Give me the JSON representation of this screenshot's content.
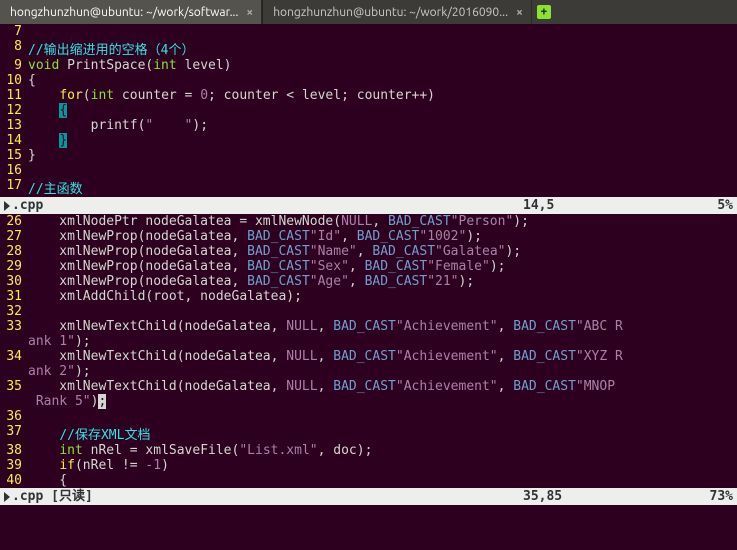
{
  "tabs": [
    {
      "label": "hongzhunzhun@ubuntu: ~/work/softwar...",
      "active": true
    },
    {
      "label": "hongzhunzhun@ubuntu: ~/work/2016090...",
      "active": false
    }
  ],
  "pane1": {
    "filename_suffix": ".cpp",
    "cursor_pos": "14,5",
    "scroll_pct": "5%",
    "lines": [
      {
        "n": 7,
        "tokens": []
      },
      {
        "n": 8,
        "tokens": [
          {
            "t": "//输出缩进用的空格（4个）",
            "cls": "c-comment"
          }
        ]
      },
      {
        "n": 9,
        "tokens": [
          {
            "t": "void",
            "cls": "c-type"
          },
          {
            "t": " PrintSpace("
          },
          {
            "t": "int",
            "cls": "c-type"
          },
          {
            "t": " level)"
          }
        ]
      },
      {
        "n": 10,
        "tokens": [
          {
            "t": "{"
          }
        ]
      },
      {
        "n": 11,
        "tokens": [
          {
            "t": "    "
          },
          {
            "t": "for",
            "cls": "c-kw"
          },
          {
            "t": "("
          },
          {
            "t": "int",
            "cls": "c-type"
          },
          {
            "t": " counter = "
          },
          {
            "t": "0",
            "cls": "c-num"
          },
          {
            "t": "; counter < level; counter++)"
          }
        ]
      },
      {
        "n": 12,
        "tokens": [
          {
            "t": "    "
          },
          {
            "t": "{",
            "cls": "hlbrace"
          }
        ]
      },
      {
        "n": 13,
        "tokens": [
          {
            "t": "        printf("
          },
          {
            "t": "\"    \"",
            "cls": "c-str"
          },
          {
            "t": ");"
          }
        ]
      },
      {
        "n": 14,
        "tokens": [
          {
            "t": "    "
          },
          {
            "t": "}",
            "cls": "hlbrace"
          }
        ]
      },
      {
        "n": 15,
        "tokens": [
          {
            "t": "}"
          }
        ]
      },
      {
        "n": 16,
        "tokens": []
      },
      {
        "n": 17,
        "tokens": [
          {
            "t": "//主函数",
            "cls": "c-comment"
          }
        ]
      }
    ]
  },
  "pane2": {
    "filename_suffix": ".cpp",
    "readonly_label": " [只读]",
    "cursor_pos": "35,85",
    "scroll_pct": "73%",
    "lines": [
      {
        "n": 26,
        "tokens": [
          {
            "t": "    xmlNodePtr nodeGalatea = xmlNewNode("
          },
          {
            "t": "NULL",
            "cls": "c-null"
          },
          {
            "t": ", "
          },
          {
            "t": "BAD_CAST",
            "cls": "c-macro"
          },
          {
            "t": "\"Person\"",
            "cls": "c-str"
          },
          {
            "t": ");"
          }
        ]
      },
      {
        "n": 27,
        "tokens": [
          {
            "t": "    xmlNewProp(nodeGalatea, "
          },
          {
            "t": "BAD_CAST",
            "cls": "c-macro"
          },
          {
            "t": "\"Id\"",
            "cls": "c-str"
          },
          {
            "t": ", "
          },
          {
            "t": "BAD_CAST",
            "cls": "c-macro"
          },
          {
            "t": "\"1002\"",
            "cls": "c-str"
          },
          {
            "t": ");"
          }
        ]
      },
      {
        "n": 28,
        "tokens": [
          {
            "t": "    xmlNewProp(nodeGalatea, "
          },
          {
            "t": "BAD_CAST",
            "cls": "c-macro"
          },
          {
            "t": "\"Name\"",
            "cls": "c-str"
          },
          {
            "t": ", "
          },
          {
            "t": "BAD_CAST",
            "cls": "c-macro"
          },
          {
            "t": "\"Galatea\"",
            "cls": "c-str"
          },
          {
            "t": ");"
          }
        ]
      },
      {
        "n": 29,
        "tokens": [
          {
            "t": "    xmlNewProp(nodeGalatea, "
          },
          {
            "t": "BAD_CAST",
            "cls": "c-macro"
          },
          {
            "t": "\"Sex\"",
            "cls": "c-str"
          },
          {
            "t": ", "
          },
          {
            "t": "BAD_CAST",
            "cls": "c-macro"
          },
          {
            "t": "\"Female\"",
            "cls": "c-str"
          },
          {
            "t": ");"
          }
        ]
      },
      {
        "n": 30,
        "tokens": [
          {
            "t": "    xmlNewProp(nodeGalatea, "
          },
          {
            "t": "BAD_CAST",
            "cls": "c-macro"
          },
          {
            "t": "\"Age\"",
            "cls": "c-str"
          },
          {
            "t": ", "
          },
          {
            "t": "BAD_CAST",
            "cls": "c-macro"
          },
          {
            "t": "\"21\"",
            "cls": "c-str"
          },
          {
            "t": ");"
          }
        ]
      },
      {
        "n": 31,
        "tokens": [
          {
            "t": "    xmlAddChild(root, nodeGalatea);"
          }
        ]
      },
      {
        "n": 32,
        "tokens": []
      },
      {
        "n": 33,
        "tokens": [
          {
            "t": "    xmlNewTextChild(nodeGalatea, "
          },
          {
            "t": "NULL",
            "cls": "c-null"
          },
          {
            "t": ", "
          },
          {
            "t": "BAD_CAST",
            "cls": "c-macro"
          },
          {
            "t": "\"Achievement\"",
            "cls": "c-str"
          },
          {
            "t": ", "
          },
          {
            "t": "BAD_CAST",
            "cls": "c-macro"
          },
          {
            "t": "\"ABC R",
            "cls": "c-str"
          }
        ]
      },
      {
        "n": "",
        "tokens": [
          {
            "t": "ank 1\"",
            "cls": "c-str"
          },
          {
            "t": ");"
          }
        ]
      },
      {
        "n": 34,
        "tokens": [
          {
            "t": "    xmlNewTextChild(nodeGalatea, "
          },
          {
            "t": "NULL",
            "cls": "c-null"
          },
          {
            "t": ", "
          },
          {
            "t": "BAD_CAST",
            "cls": "c-macro"
          },
          {
            "t": "\"Achievement\"",
            "cls": "c-str"
          },
          {
            "t": ", "
          },
          {
            "t": "BAD_CAST",
            "cls": "c-macro"
          },
          {
            "t": "\"XYZ R",
            "cls": "c-str"
          }
        ]
      },
      {
        "n": "",
        "tokens": [
          {
            "t": "ank 2\"",
            "cls": "c-str"
          },
          {
            "t": ");"
          }
        ]
      },
      {
        "n": 35,
        "tokens": [
          {
            "t": "    xmlNewTextChild(nodeGalatea, "
          },
          {
            "t": "NULL",
            "cls": "c-null"
          },
          {
            "t": ", "
          },
          {
            "t": "BAD_CAST",
            "cls": "c-macro"
          },
          {
            "t": "\"Achievement\"",
            "cls": "c-str"
          },
          {
            "t": ", "
          },
          {
            "t": "BAD_CAST",
            "cls": "c-macro"
          },
          {
            "t": "\"MNOP",
            "cls": "c-str"
          }
        ]
      },
      {
        "n": "",
        "tokens": [
          {
            "t": " Rank 5\"",
            "cls": "c-str"
          },
          {
            "t": ")"
          },
          {
            "t": ";",
            "cls": "cursor-block"
          }
        ]
      },
      {
        "n": 36,
        "tokens": []
      },
      {
        "n": 37,
        "tokens": [
          {
            "t": "    "
          },
          {
            "t": "//保存XML文档",
            "cls": "c-comment"
          }
        ]
      },
      {
        "n": 38,
        "tokens": [
          {
            "t": "    "
          },
          {
            "t": "int",
            "cls": "c-type"
          },
          {
            "t": " nRel = xmlSaveFile("
          },
          {
            "t": "\"List.xml\"",
            "cls": "c-str"
          },
          {
            "t": ", doc);"
          }
        ]
      },
      {
        "n": 39,
        "tokens": [
          {
            "t": "    "
          },
          {
            "t": "if",
            "cls": "c-kw"
          },
          {
            "t": "(nRel != "
          },
          {
            "t": "-1",
            "cls": "c-num"
          },
          {
            "t": ")"
          }
        ]
      },
      {
        "n": 40,
        "tokens": [
          {
            "t": "    {"
          }
        ]
      }
    ]
  }
}
